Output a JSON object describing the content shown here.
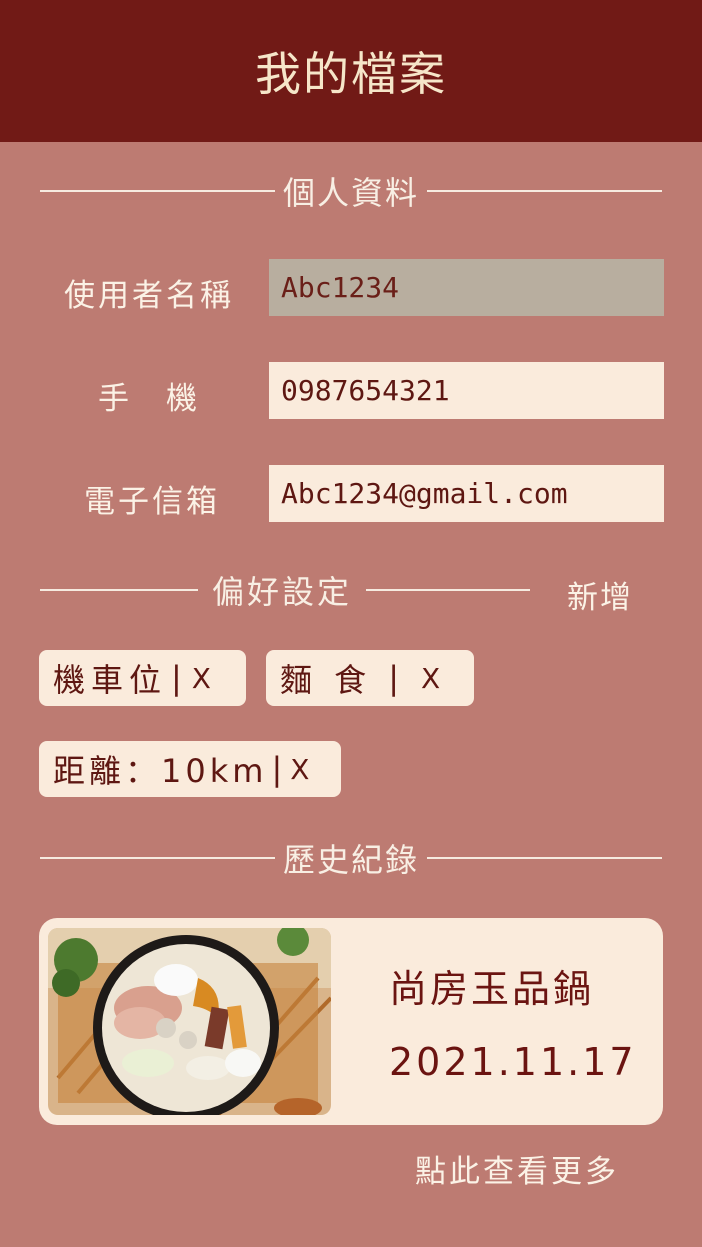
{
  "header": {
    "title": "我的檔案"
  },
  "profile": {
    "section_title": "個人資料",
    "username": {
      "label": "使用者名稱",
      "value": "Abc1234"
    },
    "phone": {
      "label": "手　機",
      "value": "0987654321"
    },
    "email": {
      "label": "電子信箱",
      "value": "Abc1234@gmail.com"
    }
  },
  "preferences": {
    "section_title": "偏好設定",
    "add_label": "新增",
    "chips": [
      {
        "text": "機車位",
        "remove": "X"
      },
      {
        "text": "麵 食",
        "remove": "X"
      },
      {
        "text": "距離：10km",
        "remove": "X"
      }
    ]
  },
  "history": {
    "section_title": "歷史紀錄",
    "items": [
      {
        "name": "尚房玉品鍋",
        "date": "2021.11.17",
        "image": "hotpot-noodle-bowl"
      }
    ],
    "more_label": "點此查看更多"
  },
  "colors": {
    "header_bg": "#711a16",
    "page_bg": "#bd7b72",
    "card_bg": "#faebdc",
    "readonly_field_bg": "#b8ae9f",
    "text_dark": "#6b1411"
  }
}
